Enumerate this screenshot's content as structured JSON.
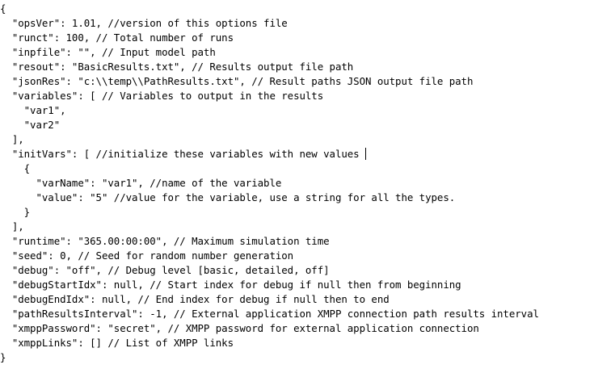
{
  "editor": {
    "lines": [
      "{",
      "  \"opsVer\": 1.01, //version of this options file",
      "  \"runct\": 100, // Total number of runs",
      "  \"inpfile\": \"\", // Input model path",
      "  \"resout\": \"BasicResults.txt\", // Results output file path",
      "  \"jsonRes\": \"c:\\\\temp\\\\PathResults.txt\", // Result paths JSON output file path",
      "  \"variables\": [ // Variables to output in the results",
      "    \"var1\",",
      "    \"var2\"",
      "  ],",
      "  \"initVars\": [ //initialize these variables with new values",
      "    {",
      "      \"varName\": \"var1\", //name of the variable",
      "      \"value\": \"5\" //value for the variable, use a string for all the types.",
      "    }",
      "  ],",
      "  \"runtime\": \"365.00:00:00\", // Maximum simulation time",
      "  \"seed\": 0, // Seed for random number generation",
      "  \"debug\": \"off\", // Debug level [basic, detailed, off]",
      "  \"debugStartIdx\": null, // Start index for debug if null then from beginning",
      "  \"debugEndIdx\": null, // End index for debug if null then to end",
      "  \"pathResultsInterval\": -1, // External application XMPP connection path results interval",
      "  \"xmppPassword\": \"secret\", // XMPP password for external application connection",
      "  \"xmppLinks\": [] // List of XMPP links",
      "}"
    ]
  }
}
